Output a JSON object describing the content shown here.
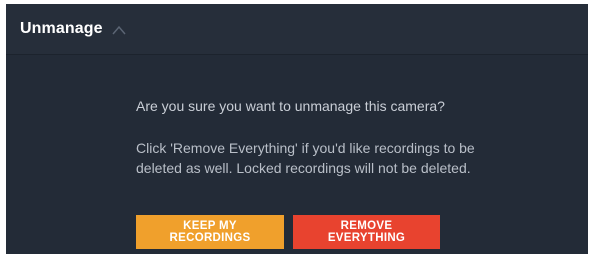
{
  "header": {
    "title": "Unmanage",
    "toggle_icon": "chevron-up-icon"
  },
  "dialog": {
    "question": "Are you sure you want to unmanage this camera?",
    "detail": "Click 'Remove Everything' if you'd like recordings to be deleted as well. Locked recordings will not be deleted."
  },
  "buttons": {
    "keep_label": "KEEP MY RECORDINGS",
    "remove_label": "REMOVE EVERYTHING"
  },
  "colors": {
    "panel_bg": "#232b37",
    "keep_button": "#f0a02c",
    "remove_button": "#e8432f"
  }
}
